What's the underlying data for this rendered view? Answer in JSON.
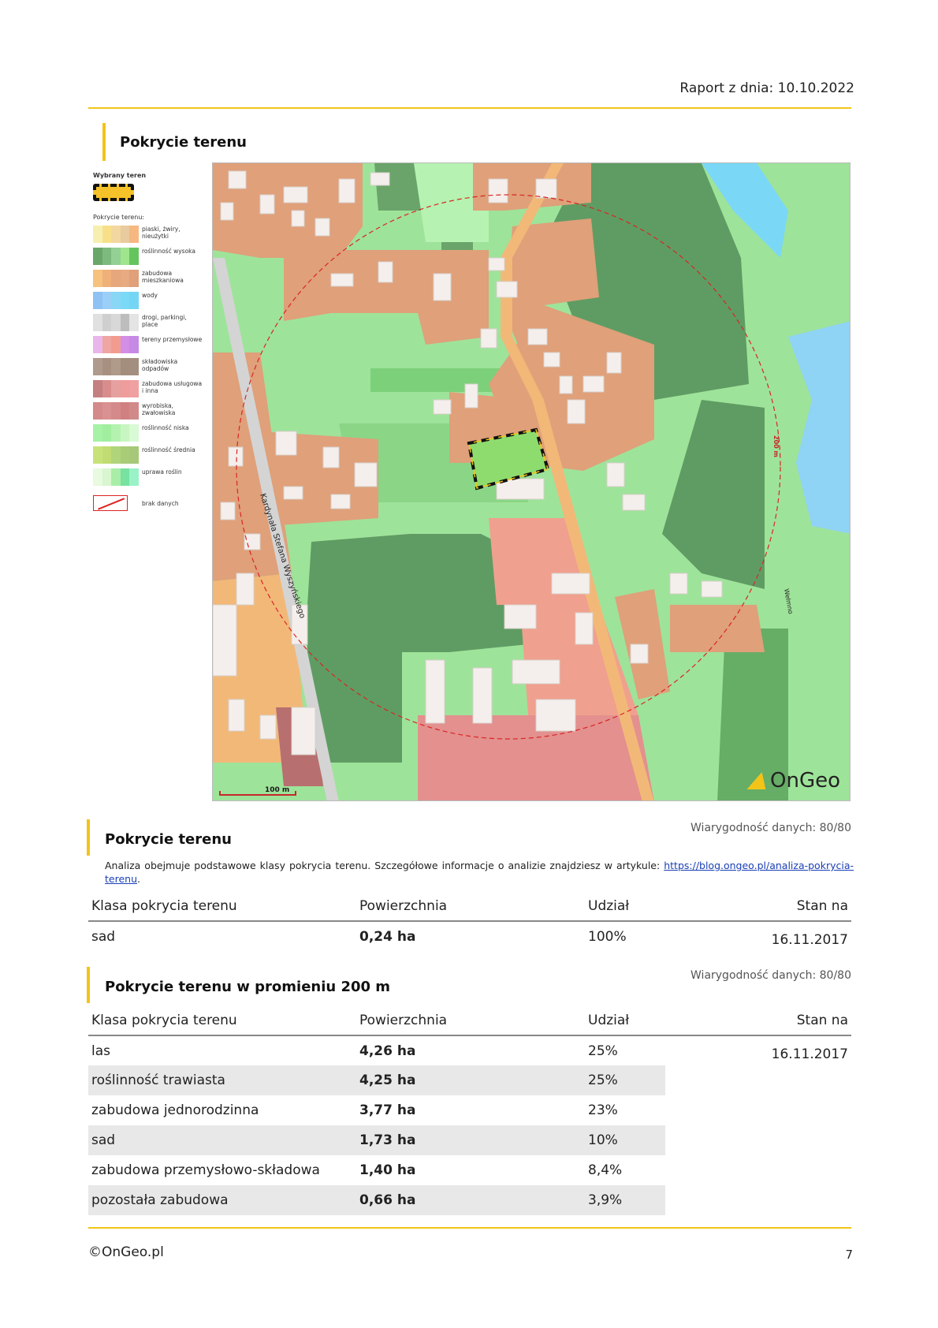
{
  "header": {
    "report_date": "Raport z dnia: 10.10.2022"
  },
  "map_section": {
    "title": "Pokrycie terenu",
    "legend": {
      "selected_title": "Wybrany teren",
      "cover_title": "Pokrycie terenu:",
      "items": [
        {
          "label": "piaski, żwiry, nieużytki",
          "colors": [
            "#f7efb0",
            "#f8e08a",
            "#f3d7a0",
            "#e9cba0",
            "#f6b880"
          ]
        },
        {
          "label": "roślinność wysoka",
          "colors": [
            "#6aa66a",
            "#7dba7d",
            "#94cf94",
            "#9ee58c",
            "#66c45e"
          ]
        },
        {
          "label": "zabudowa mieszkaniowa",
          "colors": [
            "#f6c27e",
            "#f0b07a",
            "#e7a77c",
            "#e8aa80",
            "#dfa07a"
          ]
        },
        {
          "label": "wody",
          "colors": [
            "#8fc1f3",
            "#9ad0f7",
            "#8ad6f5",
            "#7ad9f6",
            "#74d5f5"
          ]
        },
        {
          "label": "drogi, parkingi, place",
          "colors": [
            "#e0e0e0",
            "#cfcfcf",
            "#d8d8d8",
            "#bdbdbd",
            "#e4e4e4"
          ]
        },
        {
          "label": "tereny przemysłowe",
          "colors": [
            "#e8b6e8",
            "#f0a6a0",
            "#f29c90",
            "#d38ee6",
            "#c78ae4"
          ]
        },
        {
          "label": "składowiska odpadów",
          "colors": [
            "#b09a8e",
            "#a89080",
            "#b09a8a",
            "#a38e7e",
            "#a48e80"
          ]
        },
        {
          "label": "zabudowa usługowa i inna",
          "colors": [
            "#c48080",
            "#d98c8c",
            "#e6a0a0",
            "#ee9c9c",
            "#f0a0a0"
          ]
        },
        {
          "label": "wyrobiska, zwałowiska",
          "colors": [
            "#d48a8a",
            "#d99191",
            "#d48a8a",
            "#d08080",
            "#d08a8a"
          ]
        },
        {
          "label": "roślinność niska",
          "colors": [
            "#a6f2a6",
            "#a0ee9e",
            "#b4f2b0",
            "#c8f6c2",
            "#d8fad4"
          ]
        },
        {
          "label": "roślinność średnia",
          "colors": [
            "#c8e27a",
            "#c0dc72",
            "#b0d47a",
            "#a8cc78",
            "#a6c878"
          ]
        },
        {
          "label": "uprawa roślin",
          "colors": [
            "#e8fae0",
            "#d8f6d0",
            "#a8eea8",
            "#78e2a0",
            "#9af2c8"
          ]
        }
      ],
      "no_data_label": "brak danych"
    },
    "map_labels": {
      "street": "Kardynała Stefana Wyszyńskiego",
      "street2": "Wełmno",
      "radius": "200 m",
      "scale": "100 m",
      "logo": "OnGeo"
    }
  },
  "parcel_section": {
    "title": "Pokrycie terenu",
    "reliability": "Wiarygodność danych: 80/80",
    "description_prefix": "Analiza obejmuje podstawowe klasy pokrycia terenu. Szczegółowe informacje o analizie znajdziesz w artykule: ",
    "link_text": "https://blog.ongeo.pl/analiza-pokrycia-terenu",
    "description_suffix": ".",
    "columns": [
      "Klasa pokrycia terenu",
      "Powierzchnia",
      "Udział",
      "Stan na"
    ],
    "rows": [
      {
        "class": "sad",
        "area": "0,24 ha",
        "share": "100%",
        "date": "16.11.2017"
      }
    ]
  },
  "radius_section": {
    "title": "Pokrycie terenu w promieniu 200 m",
    "reliability": "Wiarygodność danych: 80/80",
    "columns": [
      "Klasa pokrycia terenu",
      "Powierzchnia",
      "Udział",
      "Stan na"
    ],
    "date": "16.11.2017",
    "rows": [
      {
        "class": "las",
        "area": "4,26 ha",
        "share": "25%"
      },
      {
        "class": "roślinność trawiasta",
        "area": "4,25 ha",
        "share": "25%"
      },
      {
        "class": "zabudowa jednorodzinna",
        "area": "3,77 ha",
        "share": "23%"
      },
      {
        "class": "sad",
        "area": "1,73 ha",
        "share": "10%"
      },
      {
        "class": "zabudowa przemysłowo-składowa",
        "area": "1,40 ha",
        "share": "8,4%"
      },
      {
        "class": "pozostała zabudowa",
        "area": "0,66 ha",
        "share": "3,9%"
      }
    ]
  },
  "footer": {
    "copyright": "©OnGeo.pl",
    "page_number": "7"
  }
}
